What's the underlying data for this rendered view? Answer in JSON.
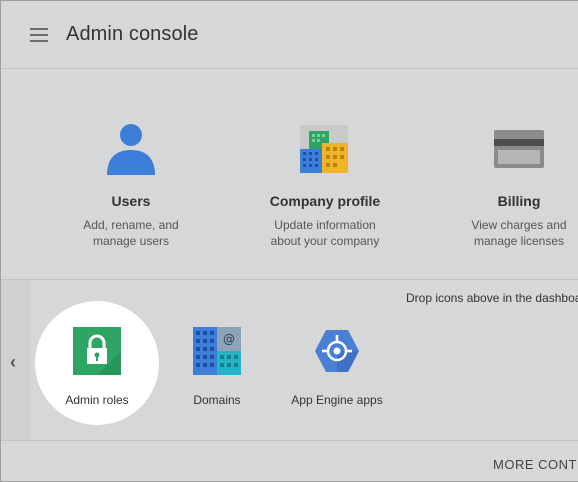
{
  "header": {
    "title": "Admin console",
    "menu_icon": "hamburger-menu-icon"
  },
  "cards": [
    {
      "title": "Users",
      "desc_line1": "Add, rename, and",
      "desc_line2": "manage users",
      "icon": "user-icon"
    },
    {
      "title": "Company profile",
      "desc_line1": "Update information",
      "desc_line2": "about your company",
      "icon": "company-buildings-icon"
    },
    {
      "title": "Billing",
      "desc_line1": "View charges and",
      "desc_line2": "manage licenses",
      "icon": "credit-card-icon"
    }
  ],
  "tray": {
    "hint": "Drop icons above in the dashboa",
    "back_icon": "chevron-left-icon",
    "items": [
      {
        "label": "Admin roles",
        "icon": "lock-icon",
        "selected": true
      },
      {
        "label": "Domains",
        "icon": "domains-icon",
        "selected": false
      },
      {
        "label": "App Engine apps",
        "icon": "app-engine-icon",
        "selected": false
      }
    ]
  },
  "footer": {
    "more_controls": "MORE CONTR"
  },
  "colors": {
    "background": "#d6d7d9",
    "user_blue": "#3d7fd8",
    "lock_green": "#2ea465",
    "app_engine_blue": "#4a7fd4"
  }
}
